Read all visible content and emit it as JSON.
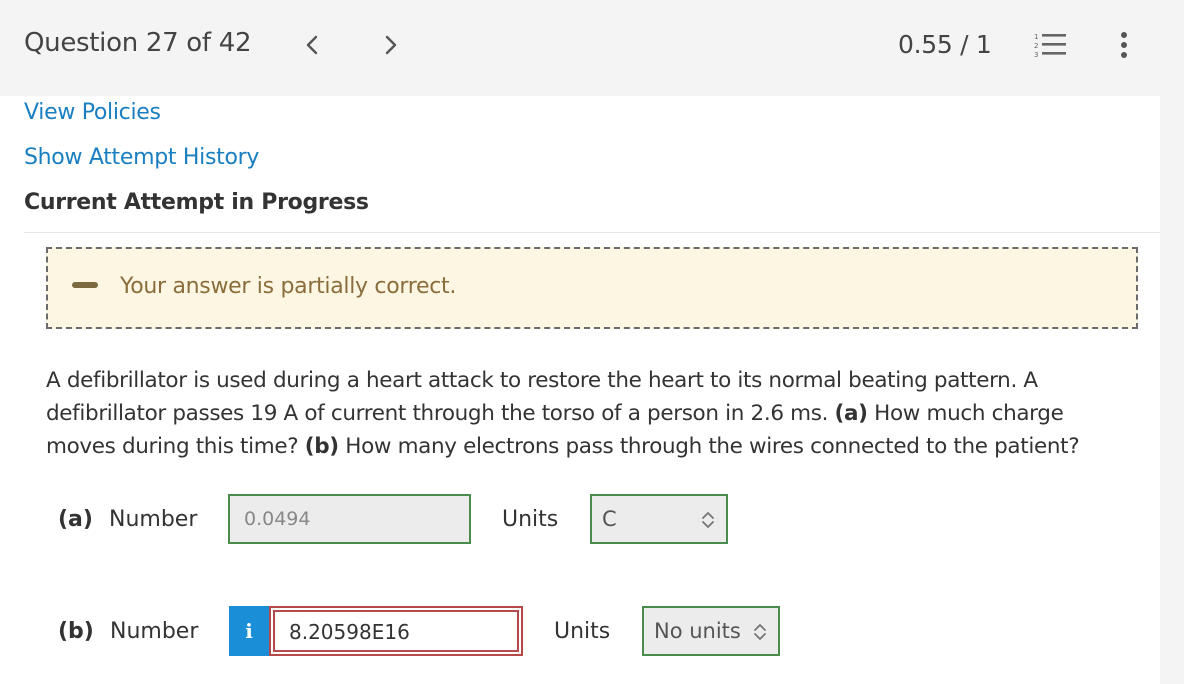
{
  "header": {
    "question_counter": "Question 27 of 42",
    "score": "0.55 / 1"
  },
  "links": {
    "view_policies": "View Policies",
    "show_attempt_history": "Show Attempt History"
  },
  "attempt_status": "Current Attempt in Progress",
  "feedback": {
    "message": "Your answer is partially correct."
  },
  "question": {
    "text_1": "A defibrillator is used during a heart attack to restore the heart to its normal beating pattern. A defibrillator passes 19 A of current through the torso of a person in 2.6 ms. ",
    "part_a_tag": "(a)",
    "text_2": " How much charge moves during this time? ",
    "part_b_tag": "(b)",
    "text_3": " How many electrons pass through the wires connected to the patient?"
  },
  "answers": {
    "part_a": {
      "label": "(a)",
      "number_label": "Number",
      "value": "0.0494",
      "units_label": "Units",
      "units_value": "C"
    },
    "part_b": {
      "label": "(b)",
      "number_label": "Number",
      "info_icon_label": "i",
      "value": "8.20598E16",
      "units_label": "Units",
      "units_value": "No units"
    }
  },
  "colors": {
    "link": "#1a7fc1",
    "feedback_bg": "#fcf6e3",
    "feedback_text": "#8a6d3b",
    "correct_border": "#4b8b4b",
    "incorrect_border": "#b54a4a",
    "info_button": "#1a8fd8"
  },
  "icons": [
    "chevron-left-icon",
    "chevron-right-icon",
    "numbered-list-icon",
    "more-vertical-icon",
    "partial-dash-icon",
    "info-icon",
    "select-chevron-icon"
  ]
}
